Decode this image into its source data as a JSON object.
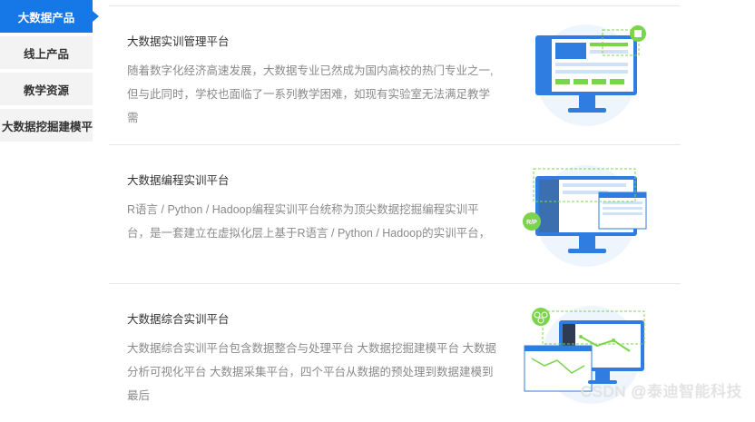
{
  "sidebar": {
    "items": [
      {
        "label": "大数据产品",
        "active": true
      },
      {
        "label": "线上产品",
        "active": false
      },
      {
        "label": "教学资源",
        "active": false
      },
      {
        "label": "大数据挖掘建模平",
        "active": false
      }
    ]
  },
  "products": [
    {
      "title": "大数据实训管理平台",
      "description": "随着数字化经济高速发展，大数据专业已然成为国内高校的热门专业之一,但与此同时，学校也面临了一系列教学困难，如现有实验室无法满足教学需",
      "illustration": "monitor-dashboard-icon",
      "badge": "doc-icon"
    },
    {
      "title": "大数据编程实训平台",
      "description": "R语言 / Python / Hadoop编程实训平台统称为顶尖数据挖掘编程实训平台，是一套建立在虚拟化层上基于R语言 / Python / Hadoop的实训平台，",
      "illustration": "monitor-ide-icon",
      "badge_text": "R/P"
    },
    {
      "title": "大数据综合实训平台",
      "description": "大数据综合实训平台包含数据整合与处理平台 大数据挖掘建模平台 大数据分析可视化平台 大数据采集平台，四个平台从数据的预处理到数据建模到最后",
      "illustration": "monitor-workflow-icon",
      "badge": "share-icon"
    }
  ],
  "watermark": "CSDN @泰迪智能科技",
  "colors": {
    "accent": "#1677e6",
    "green": "#7bd44a",
    "blue_light": "#e8f2fd"
  }
}
